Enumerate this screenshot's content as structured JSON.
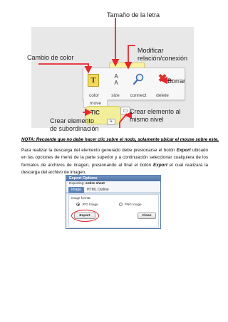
{
  "figure1": {
    "callouts": {
      "font_size": "Tamaño de la letra",
      "modify": "Modificar\nrelación/conexión",
      "color_change": "Cambio de color",
      "delete": "Borrar",
      "create_child": "Crear elemento\nde subordinación",
      "create_sibling": "Crear elemento al\nmismo nivel"
    },
    "toolbar": {
      "color": "color",
      "size": "size",
      "connect": "connect",
      "delete": "delete",
      "move": "move",
      "size_glyph": "A\nA"
    },
    "node_label": "TIC",
    "accent": "#e8262c"
  },
  "nota": "NOTA: Recuerde que no debe hacer clic sobre el nodo, solamente ubicar el mouse sobre este.",
  "paragraph": {
    "part1": "Para realizar la descarga del elemento generado debe presionarse el botón ",
    "export1": "Export",
    "part2": " ubicado en las opciones de menú de la parte superior y a continuación seleccionar cualquiera de los formatos de archivos de imagen, presionando al final el botón ",
    "export2": "Export",
    "part3": " el cual realizará la descarga del archivo de imagen."
  },
  "dialog": {
    "title": "Export Options",
    "exporting_label": "Exporting:",
    "exporting_value": "entire sheet",
    "tab_image": "Image",
    "tab_html": "HTML Outline",
    "format_label": "Image format:",
    "option_jpg": "JPG Image",
    "option_png": "PNG Image",
    "export_button": "Export",
    "close_button": "Close"
  }
}
